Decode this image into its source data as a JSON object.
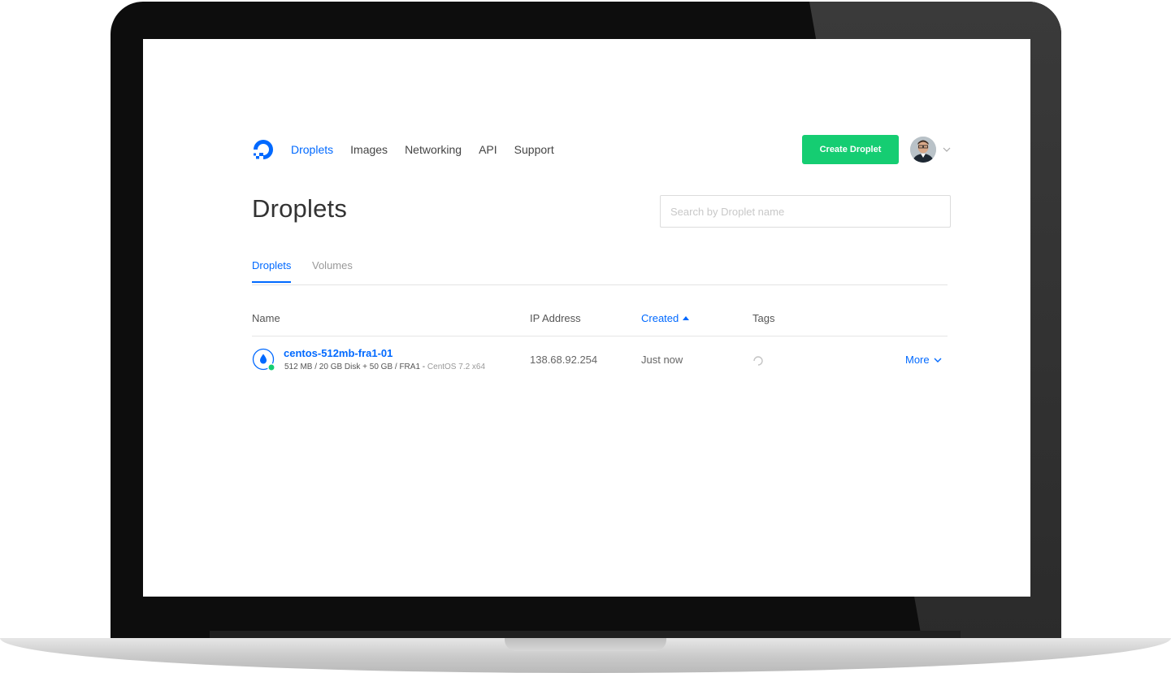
{
  "nav": {
    "items": [
      {
        "label": "Droplets",
        "active": true
      },
      {
        "label": "Images"
      },
      {
        "label": "Networking"
      },
      {
        "label": "API"
      },
      {
        "label": "Support"
      }
    ],
    "create_button": "Create Droplet"
  },
  "page": {
    "title": "Droplets",
    "search_placeholder": "Search by Droplet name"
  },
  "tabs": [
    {
      "label": "Droplets",
      "active": true
    },
    {
      "label": "Volumes"
    }
  ],
  "table": {
    "columns": [
      "Name",
      "IP Address",
      "Created",
      "Tags"
    ],
    "sorted_column": "Created",
    "rows": [
      {
        "name": "centos-512mb-fra1-01",
        "specs": "512 MB / 20 GB Disk + 50 GB / FRA1 - ",
        "os": "CentOS 7.2 x64",
        "ip": "138.68.92.254",
        "created": "Just now",
        "status": "active",
        "action": "More"
      }
    ]
  },
  "colors": {
    "accent": "#0069ff",
    "create_button": "#15cd72",
    "status_active": "#15cd72"
  },
  "icons": [
    "digitalocean-logo-icon",
    "avatar",
    "chevron-down-icon",
    "sort-up-icon",
    "droplet-icon",
    "loading-spinner-icon"
  ]
}
